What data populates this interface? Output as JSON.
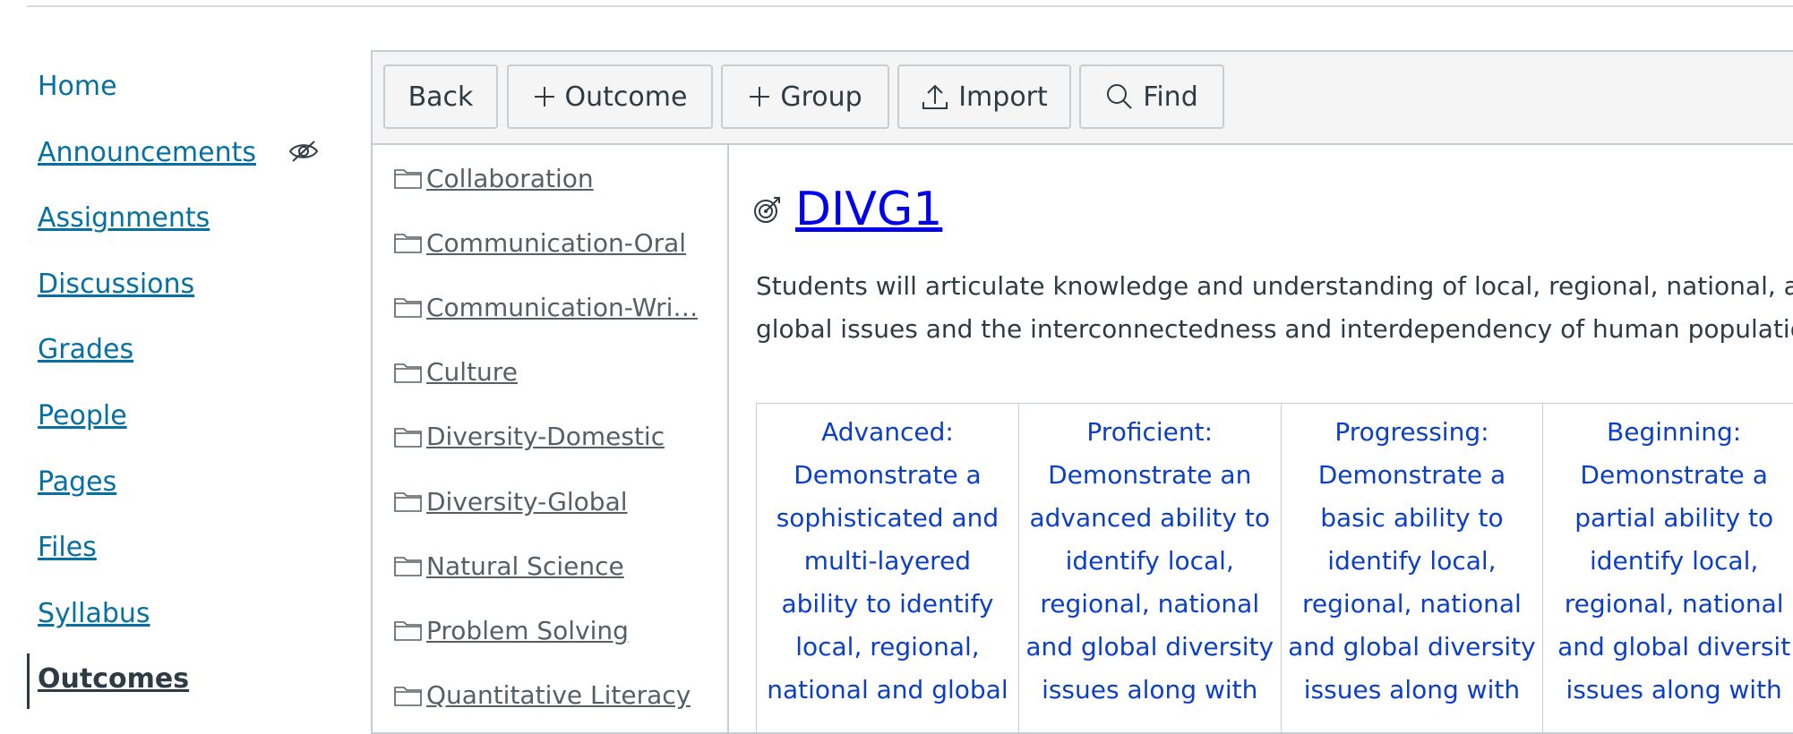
{
  "nav": {
    "items": [
      {
        "label": "Home"
      },
      {
        "label": "Announcements"
      },
      {
        "label": "Assignments"
      },
      {
        "label": "Discussions"
      },
      {
        "label": "Grades"
      },
      {
        "label": "People"
      },
      {
        "label": "Pages"
      },
      {
        "label": "Files"
      },
      {
        "label": "Syllabus"
      },
      {
        "label": "Outcomes"
      }
    ],
    "active": "Outcomes"
  },
  "toolbar": {
    "back": "Back",
    "outcome": "Outcome",
    "group": "Group",
    "import": "Import",
    "find": "Find"
  },
  "folders": [
    "Collaboration",
    "Communication-Oral",
    "Communication-Wri…",
    "Culture",
    "Diversity-Domestic",
    "Diversity-Global",
    "Natural Science",
    "Problem Solving",
    "Quantitative Literacy"
  ],
  "outcome": {
    "title": "DIVG1",
    "description_line1": "Students will articulate knowledge and understanding of local, regional, national, ar",
    "description_line2": "global issues and the interconnectedness and interdependency of human populatio",
    "ratings": [
      {
        "lines": [
          "Advanced:",
          "Demonstrate a",
          "sophisticated and",
          "multi-layered",
          "ability to identify",
          "local, regional,",
          "national and global"
        ]
      },
      {
        "lines": [
          "Proficient:",
          "Demonstrate an",
          "advanced ability to",
          "identify local,",
          "regional, national",
          "and global diversity",
          "issues along with"
        ]
      },
      {
        "lines": [
          "Progressing:",
          "Demonstrate a",
          "basic ability to",
          "identify local,",
          "regional, national",
          "and global diversity",
          "issues along with"
        ]
      },
      {
        "lines": [
          "Beginning:",
          "Demonstrate a",
          "partial ability to",
          "identify local,",
          "regional, national",
          "and global diversit",
          "issues along with"
        ]
      }
    ]
  },
  "colors": {
    "link": "#0770a3",
    "title_link": "#0000ee",
    "rating_text": "#0b3fc9",
    "border": "#c7cdd1",
    "toolbar_bg": "#f5f5f5"
  }
}
